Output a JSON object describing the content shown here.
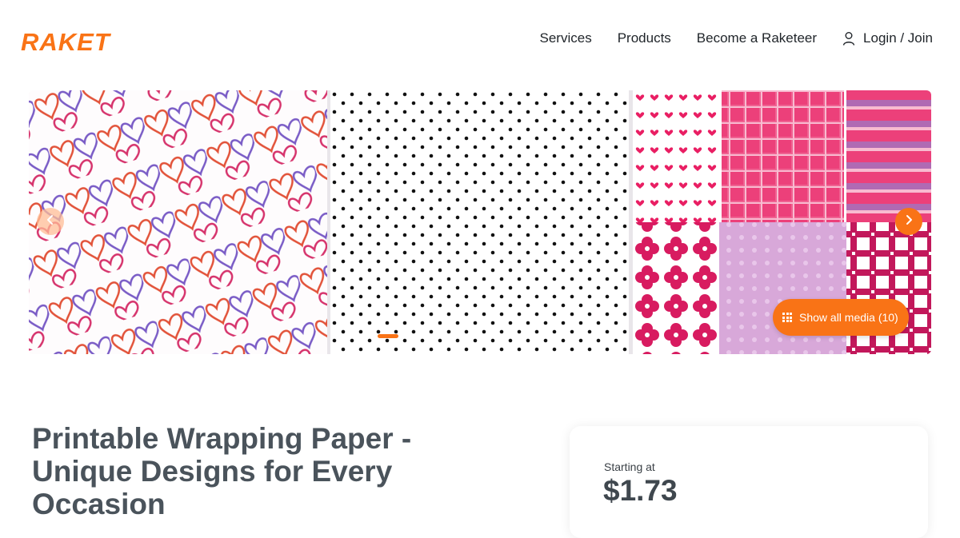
{
  "header": {
    "logo_text": "RAKET",
    "nav": {
      "services": "Services",
      "products": "Products",
      "become": "Become a Raketeer",
      "login": "Login / Join"
    }
  },
  "gallery": {
    "show_all_label": "Show all media (10)",
    "slide_count": 8,
    "active_slide": 1,
    "icons": {
      "prev": "chevron-left-icon",
      "next": "chevron-right-icon",
      "show_all": "grid-icon",
      "login": "user-icon"
    }
  },
  "product": {
    "title": "Printable Wrapping Paper - Unique Designs for Every Occasion"
  },
  "pricing": {
    "label": "Starting at",
    "value": "$1.73"
  },
  "colors": {
    "brand": "#f97316",
    "text_dark": "#1f2429",
    "title": "#4a535b"
  }
}
